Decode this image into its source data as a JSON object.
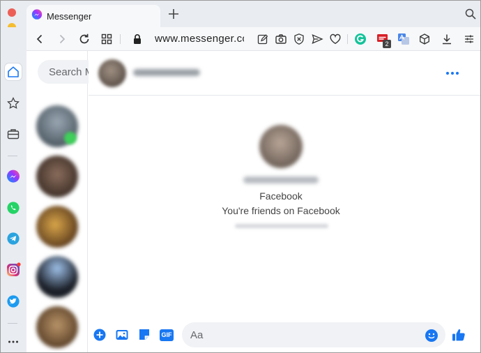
{
  "browser": {
    "tab_title": "Messenger",
    "address": "www.messenger.com",
    "extension_badge": "2"
  },
  "chat_list": {
    "search_placeholder": "Search Messenger"
  },
  "conversation": {
    "profile_line1": "Facebook",
    "profile_line2": "You're friends on Facebook"
  },
  "composer": {
    "placeholder": "Aa",
    "gif_label": "GIF"
  },
  "colors": {
    "accent": "#1877f2",
    "traffic_red": "#ec5f57",
    "traffic_yellow": "#f5bd30",
    "traffic_green": "#2ec840"
  }
}
